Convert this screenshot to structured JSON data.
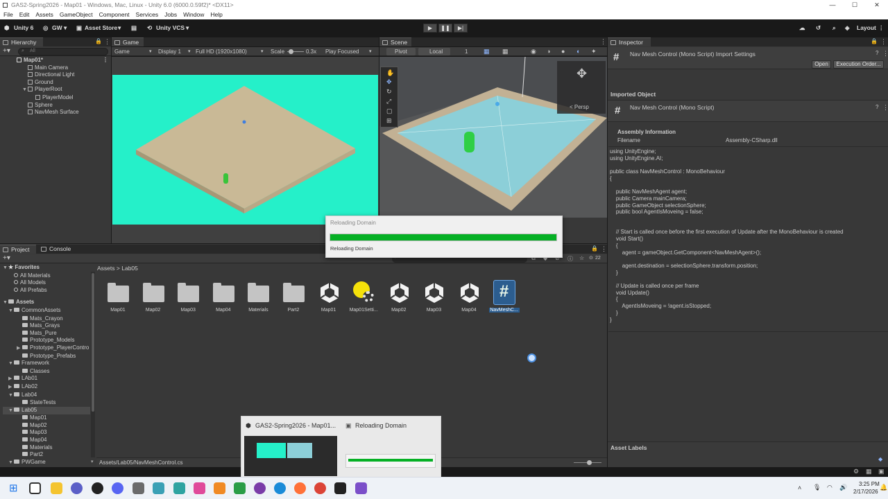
{
  "window": {
    "title": "GAS2-Spring2026 - Map01 - Windows, Mac, Linux - Unity 6.0 (6000.0.59f2)* <DX11>",
    "menu": [
      "File",
      "Edit",
      "Assets",
      "GameObject",
      "Component",
      "Services",
      "Jobs",
      "Window",
      "Help"
    ]
  },
  "toolbar": {
    "unity": "Unity 6",
    "account": "GW",
    "asset_store": "Asset Store",
    "vcs": "Unity VCS",
    "layout": "Layout"
  },
  "hierarchy": {
    "tab": "Hierarchy",
    "search_placeholder": "All",
    "scene": "Map01*",
    "items": [
      "Main Camera",
      "Directional Light",
      "Ground",
      "PlayerRoot",
      "PlayerModel",
      "Sphere",
      "NavMesh Surface"
    ]
  },
  "game": {
    "tab": "Game",
    "mode": "Game",
    "display": "Display 1",
    "resolution": "Full HD (1920x1080)",
    "scale_label": "Scale",
    "scale_value": "0.3x",
    "play_focused": "Play Focused",
    "bg_color": "#25f0c9"
  },
  "scene": {
    "tab": "Scene",
    "pivot": "Pivot",
    "local": "Local",
    "grid_value": "1",
    "persp": "< Persp"
  },
  "inspector": {
    "tab": "Inspector",
    "title": "Nav Mesh Control (Mono Script) Import Settings",
    "open_button": "Open",
    "exec_order_button": "Execution Order...",
    "imported_object": "Imported Object",
    "object_name": "Nav Mesh Control (Mono Script)",
    "assembly_info": "Assembly Information",
    "filename_label": "Filename",
    "filename_value": "Assembly-CSharp.dll",
    "code": "using UnityEngine;\nusing UnityEngine.AI;\n\npublic class NavMeshControl : MonoBehaviour\n{\n\n    public NavMeshAgent agent;\n    public Camera mainCamera;\n    public GameObject selectionSphere;\n    public bool AgentIsMoveing = false;\n\n\n    // Start is called once before the first execution of Update after the MonoBehaviour is created\n    void Start()\n    {\n        agent = gameObject.GetComponent<NavMeshAgent>();\n\n        agent.destination = selectionSphere.transform.position;\n    }\n\n    // Update is called once per frame\n    void Update()\n    {\n        AgentIsMoveing = !agent.isStopped;\n    }\n}",
    "asset_labels": "Asset Labels"
  },
  "project": {
    "tab_project": "Project",
    "tab_console": "Console",
    "breadcrumb_root": "Assets",
    "breadcrumb_sep": ">",
    "breadcrumb_current": "Lab05",
    "count": "22",
    "favorites": "Favorites",
    "favorite_items": [
      "All Materials",
      "All Models",
      "All Prefabs"
    ],
    "assets_root": "Assets",
    "tree": [
      {
        "label": "CommonAssets",
        "depth": 1,
        "arrow": "▼"
      },
      {
        "label": "Mats_Crayon",
        "depth": 2,
        "arrow": ""
      },
      {
        "label": "Mats_Grays",
        "depth": 2,
        "arrow": ""
      },
      {
        "label": "Mats_Pure",
        "depth": 2,
        "arrow": ""
      },
      {
        "label": "Prototype_Models",
        "depth": 2,
        "arrow": ""
      },
      {
        "label": "Prototype_PlayerContro",
        "depth": 2,
        "arrow": "▶"
      },
      {
        "label": "Prototype_Prefabs",
        "depth": 2,
        "arrow": ""
      },
      {
        "label": "Framework",
        "depth": 1,
        "arrow": "▼"
      },
      {
        "label": "Classes",
        "depth": 2,
        "arrow": ""
      },
      {
        "label": "LAb01",
        "depth": 1,
        "arrow": "▶"
      },
      {
        "label": "LAb02",
        "depth": 1,
        "arrow": "▶"
      },
      {
        "label": "Lab04",
        "depth": 1,
        "arrow": "▼"
      },
      {
        "label": "StateTests",
        "depth": 2,
        "arrow": ""
      },
      {
        "label": "Lab05",
        "depth": 1,
        "arrow": "▼"
      },
      {
        "label": "Map01",
        "depth": 2,
        "arrow": ""
      },
      {
        "label": "Map02",
        "depth": 2,
        "arrow": ""
      },
      {
        "label": "Map03",
        "depth": 2,
        "arrow": ""
      },
      {
        "label": "Map04",
        "depth": 2,
        "arrow": ""
      },
      {
        "label": "Materials",
        "depth": 2,
        "arrow": ""
      },
      {
        "label": "Part2",
        "depth": 2,
        "arrow": ""
      },
      {
        "label": "PWGame",
        "depth": 1,
        "arrow": "▼"
      }
    ],
    "assets": [
      {
        "label": "Map01",
        "kind": "folder"
      },
      {
        "label": "Map02",
        "kind": "folder"
      },
      {
        "label": "Map03",
        "kind": "folder"
      },
      {
        "label": "Map04",
        "kind": "folder"
      },
      {
        "label": "Materials",
        "kind": "folder"
      },
      {
        "label": "Part2",
        "kind": "folder"
      },
      {
        "label": "Map01",
        "kind": "scene"
      },
      {
        "label": "Map01Setti...",
        "kind": "settings"
      },
      {
        "label": "Map02",
        "kind": "scene"
      },
      {
        "label": "Map03",
        "kind": "scene"
      },
      {
        "label": "Map04",
        "kind": "scene"
      },
      {
        "label": "NavMeshC...",
        "kind": "script"
      }
    ],
    "status_path": "Assets/Lab05/NavMeshControl.cs"
  },
  "dialog": {
    "title": "Reloading Domain",
    "message": "Reloading Domain",
    "progress": 1.0
  },
  "taskbar": {
    "preview_title": "GAS2-Spring2026 - Map01...",
    "preview_title2": "Reloading Domain",
    "time": "3:25 PM",
    "date": "2/17/2026"
  }
}
